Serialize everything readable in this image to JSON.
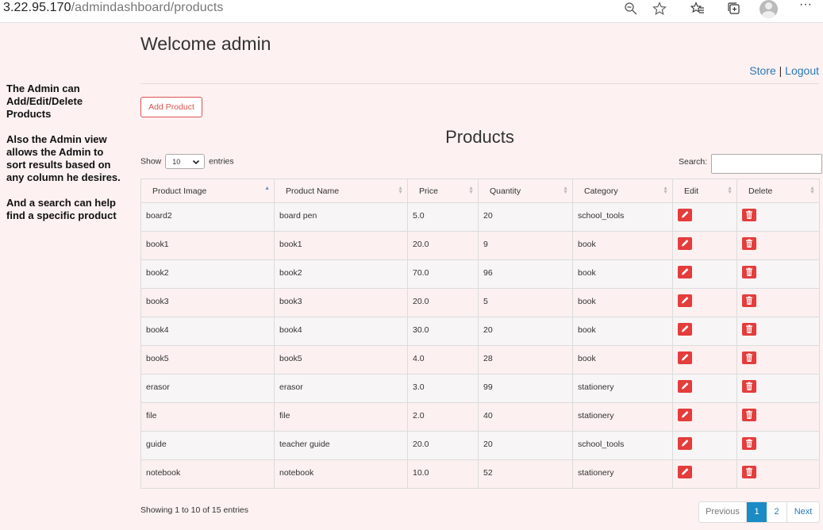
{
  "browser": {
    "url_host": "3.22.95.170",
    "url_path": "/admindashboard/products",
    "icons": [
      "zoom-out-icon",
      "star-icon",
      "favorites-icon",
      "collections-icon",
      "profile-avatar",
      "more-icon"
    ]
  },
  "sidebar": {
    "para1": "The Admin can Add/Edit/Delete Products",
    "para2": "Also the Admin view allows the Admin to sort results based on any column he desires.",
    "para3": "And a search can help find a specific product"
  },
  "header": {
    "welcome": "Welcome admin",
    "store_link": "Store",
    "separator": "|",
    "logout_link": "Logout"
  },
  "add_button": "Add Product",
  "page_title": "Products",
  "controls": {
    "show_label": "Show",
    "entries_value": "10",
    "entries_label": "entries",
    "search_label": "Search:"
  },
  "table": {
    "columns": [
      "Product Image",
      "Product Name",
      "Price",
      "Quantity",
      "Category",
      "Edit",
      "Delete"
    ],
    "rows": [
      [
        "board2",
        "board pen",
        "5.0",
        "20",
        "school_tools"
      ],
      [
        "book1",
        "book1",
        "20.0",
        "9",
        "book"
      ],
      [
        "book2",
        "book2",
        "70.0",
        "96",
        "book"
      ],
      [
        "book3",
        "book3",
        "20.0",
        "5",
        "book"
      ],
      [
        "book4",
        "book4",
        "30.0",
        "20",
        "book"
      ],
      [
        "book5",
        "book5",
        "4.0",
        "28",
        "book"
      ],
      [
        "erasor",
        "erasor",
        "3.0",
        "99",
        "stationery"
      ],
      [
        "file",
        "file",
        "2.0",
        "40",
        "stationery"
      ],
      [
        "guide",
        "teacher guide",
        "20.0",
        "20",
        "school_tools"
      ],
      [
        "notebook",
        "notebook",
        "10.0",
        "52",
        "stationery"
      ]
    ]
  },
  "footer": {
    "info": "Showing 1 to 10 of 15 entries",
    "prev": "Previous",
    "page1": "1",
    "page2": "2",
    "next": "Next"
  },
  "colors": {
    "page_bg": "#fdf1f1",
    "danger": "#e53c3c",
    "link": "#2a7ab5",
    "active_page": "#1a8bc4"
  }
}
